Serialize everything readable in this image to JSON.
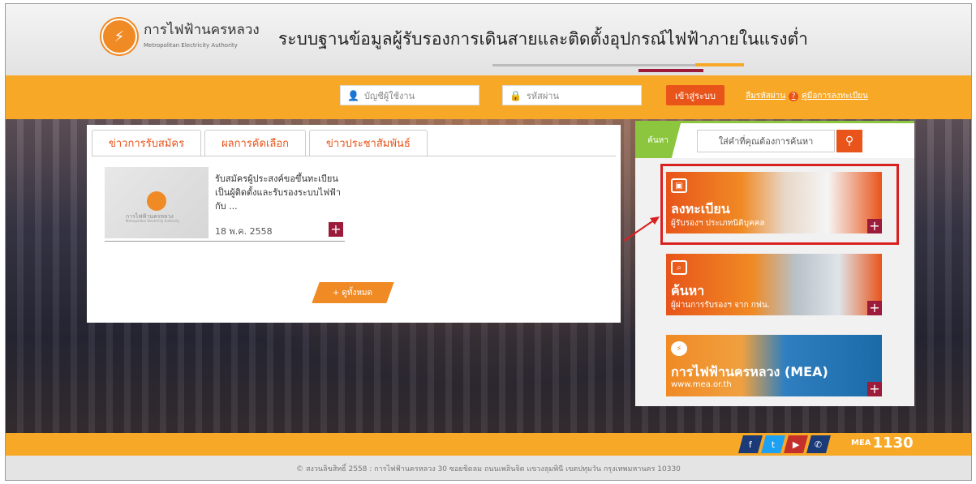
{
  "header": {
    "logo_th": "การไฟฟ้านครหลวง",
    "logo_en": "Metropolitan Electricity Authority",
    "site_title": "ระบบฐานข้อมูลผู้รับรองการเดินสายและติดตั้งอุปกรณ์ไฟฟ้าภายในแรงต่ำ"
  },
  "login": {
    "username_placeholder": "บัญชีผู้ใช้งาน",
    "password_placeholder": "รหัสผ่าน",
    "login_label": "เข้าสู่ระบบ",
    "forgot_label": "ลืมรหัสผ่าน",
    "manual_label": "คู่มือการลงทะเบียน"
  },
  "news": {
    "tabs": [
      "ข่าวการรับสมัคร",
      "ผลการคัดเลือก",
      "ข่าวประชาสัมพันธ์"
    ],
    "item": {
      "thumb_th": "การไฟฟ้านครหลวง",
      "thumb_en": "Metropolitan Electricity Authority",
      "text": "รับสมัครผู้ประสงค์ขอขึ้นทะเบียนเป็นผู้ติดตั้งและรับรองระบบไฟฟ้ากับ ...",
      "date": "18 พ.ค. 2558"
    },
    "view_all": "+ ดูทั้งหมด"
  },
  "side": {
    "search_label": "ค้นหา",
    "search_placeholder": "ใส่คำที่คุณต้องการค้นหา",
    "banners": [
      {
        "title": "ลงทะเบียน",
        "subtitle": "ผู้รับรองฯ ประเภทนิติบุคคล"
      },
      {
        "title": "ค้นหา",
        "subtitle": "ผู้ผ่านการรับรองฯ จาก กฟน."
      },
      {
        "title": "การไฟฟ้านครหลวง (MEA)",
        "subtitle": "www.mea.or.th"
      }
    ]
  },
  "footer": {
    "mea": "MEA",
    "call_center": "1130",
    "copyright": "© สงวนลิขสิทธิ์ 2558 : การไฟฟ้านครหลวง 30 ซอยชิดลม ถนนเพลินจิต แขวงลุมพินี เขตปทุมวัน กรุงเทพมหานคร 10330"
  },
  "colors": {
    "orange": "#f8a827",
    "accent": "#e8541a",
    "maroon": "#9c1b3a",
    "green": "#8cc63f",
    "highlight": "#d92020"
  }
}
